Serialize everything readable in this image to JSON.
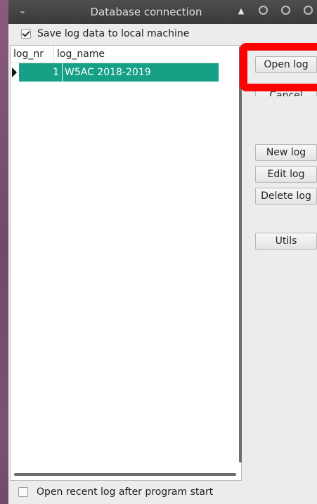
{
  "window": {
    "title": "Database connection",
    "icons": {
      "menu": "chevron-down-icon",
      "shade": "eject-icon",
      "buttons": [
        "minimize-icon",
        "maximize-icon",
        "close-icon"
      ]
    }
  },
  "options": {
    "save_log_label": "Save log data to local machine",
    "save_log_checked": true,
    "open_recent_label": "Open recent log after program start",
    "open_recent_checked": false
  },
  "log_table": {
    "columns": [
      "log_nr",
      "log_name"
    ],
    "rows": [
      {
        "log_nr": "1",
        "log_name": "W5AC 2018-2019",
        "selected": true
      }
    ],
    "selection_color": "#16a085"
  },
  "buttons": {
    "open_log": "Open log",
    "cancel": "Cancel",
    "new_log": "New log",
    "edit_log": "Edit log",
    "delete_log": "Delete log",
    "utils": "Utils"
  },
  "highlight": {
    "target": "Open log",
    "color": "#ff0000"
  }
}
